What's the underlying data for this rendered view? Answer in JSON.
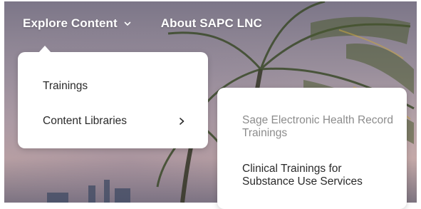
{
  "nav": {
    "explore_label": "Explore Content",
    "about_label": "About SAPC LNC"
  },
  "dropdown": {
    "items": [
      {
        "label": "Trainings"
      },
      {
        "label": "Content Libraries"
      }
    ]
  },
  "submenu": {
    "items": [
      {
        "label": "Sage Electronic Health Record Trainings",
        "state": "muted"
      },
      {
        "label": "Clinical Trainings for Substance Use Services"
      }
    ]
  },
  "icons": {
    "nav_chevron": "chevron-down-icon",
    "submenu_arrow": "chevron-right-icon"
  },
  "colors": {
    "menu_text": "#2a2a2a",
    "muted_text": "#8c8c8c",
    "nav_text": "#ffffff"
  }
}
